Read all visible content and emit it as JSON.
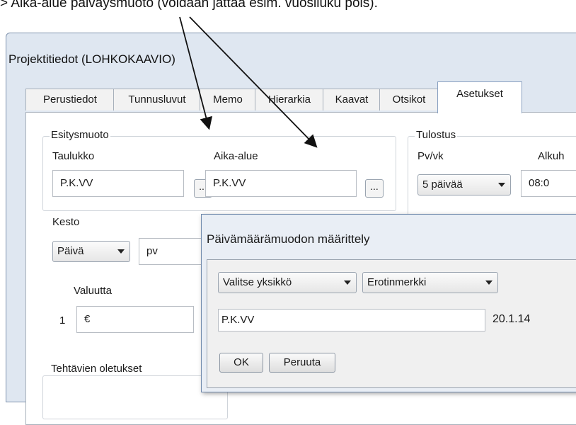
{
  "caption": "> Aika-alue päiväysmuoto (voidaan jättää esim. vuosiluku pois).",
  "window": {
    "title": "Projektitiedot (LOHKOKAAVIO)"
  },
  "tabs": [
    "Perustiedot",
    "Tunnusluvut",
    "Memo",
    "Hierarkia",
    "Kaavat",
    "Otsikot",
    "Asetukset"
  ],
  "esitysmuoto": {
    "legend": "Esitysmuoto",
    "taulukko_label": "Taulukko",
    "taulukko_value": "P.K.VV",
    "aika_label": "Aika-alue",
    "aika_value": "P.K.VV",
    "dots": "..."
  },
  "kesto": {
    "label": "Kesto",
    "unit_select": "Päivä",
    "unit_text": "pv"
  },
  "valuutta": {
    "label": "Valuutta",
    "index": "1",
    "symbol": "€"
  },
  "tulostus": {
    "legend": "Tulostus",
    "pv_label": "Pv/vk",
    "pv_select": "5 päivää",
    "alku_label": "Alkuh",
    "alku_value": "08:0"
  },
  "tehtavat": {
    "legend": "Tehtävien oletukset"
  },
  "dialog": {
    "title": "Päivämäärämuodon määrittely",
    "unit_select": "Valitse yksikkö",
    "sep_select": "Erotinmerkki",
    "format_value": "P.K.VV",
    "preview": "20.1.14",
    "ok": "OK",
    "cancel": "Peruuta"
  }
}
